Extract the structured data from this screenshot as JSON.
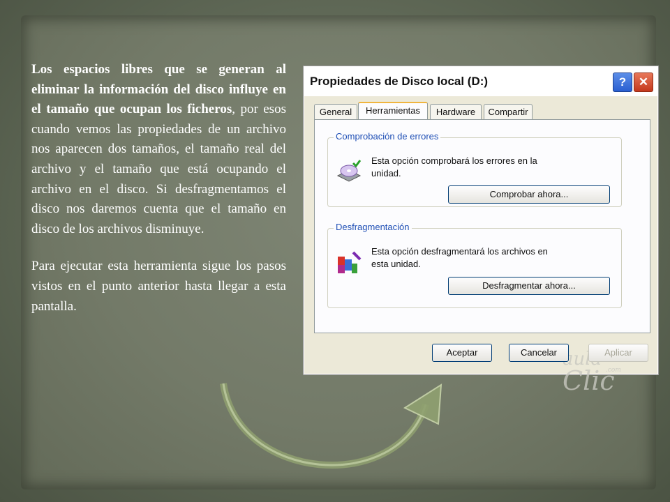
{
  "slide": {
    "paragraph1": {
      "bold": "Los espacios libres que se generan al eliminar la información del disco influye en el tamaño que ocupan los ficheros",
      "rest": ", por esos cuando vemos las propiedades de un archivo nos aparecen dos tamaños, el tamaño real del archivo y el tamaño que está ocupando el archivo en el disco. Si desfragmentamos el disco nos daremos cuenta que el tamaño en disco de los archivos disminuye."
    },
    "paragraph2": "Para ejecutar esta herramienta sigue los pasos vistos en el punto anterior hasta llegar a esta pantalla."
  },
  "dialog": {
    "title": "Propiedades de Disco local (D:)",
    "help_glyph": "?",
    "close_glyph": "✕",
    "tabs": [
      {
        "label": "General"
      },
      {
        "label": "Herramientas"
      },
      {
        "label": "Hardware"
      },
      {
        "label": "Compartir"
      }
    ],
    "error_check": {
      "label": "Comprobación de errores",
      "description": "Esta opción comprobará los errores en la unidad.",
      "button": "Comprobar ahora..."
    },
    "defrag": {
      "label": "Desfragmentación",
      "description": "Esta opción desfragmentará los archivos en esta unidad.",
      "button": "Desfragmentar ahora..."
    },
    "watermark": {
      "line1": "aula",
      "line2": "Clic",
      "small": ".com"
    },
    "footer": {
      "ok": "Aceptar",
      "cancel": "Cancelar",
      "apply": "Aplicar"
    }
  },
  "colors": {
    "arrow": "#8fa070",
    "group_label": "#1f4fb5"
  }
}
